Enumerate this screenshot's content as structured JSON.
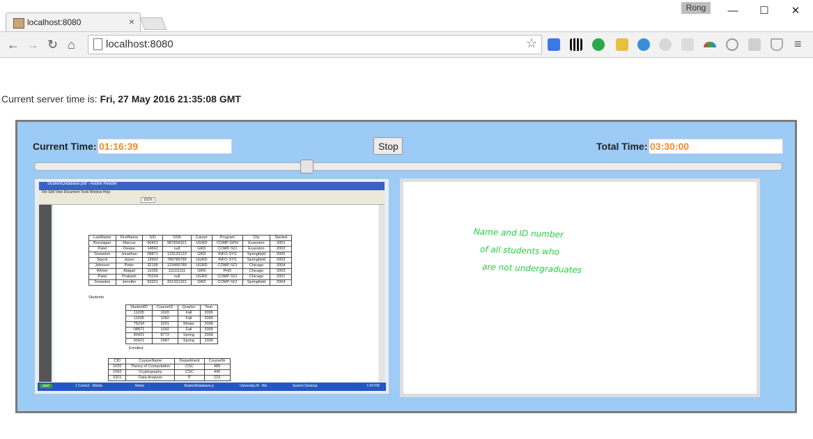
{
  "browser": {
    "tab_title": "localhost:8080",
    "url": "localhost:8080",
    "user_name": "Rong",
    "window_controls": [
      "—",
      "☐",
      "✕"
    ]
  },
  "page": {
    "server_time_label": "Current server time is: ",
    "server_time_value": "Fri, 27 May 2016 21:35:08 GMT"
  },
  "player": {
    "current_time_label": "Current Time:",
    "current_time_value": "01:16:39",
    "total_time_label": "Total Time:",
    "total_time_value": "03:30:00",
    "stop_label": "Stop",
    "progress_fraction": 0.365
  },
  "screen_capture": {
    "window_title": "StudentDatabase.pdf - Adobe Reader",
    "menu": "File  Edit  View  Document  Tools  Window  Help",
    "zoom": "101%",
    "students_caption": "Students",
    "students_headers": [
      "LastName",
      "FirstName",
      "SID",
      "SSN",
      "Career",
      "Program",
      "City",
      "Started"
    ],
    "students_rows": [
      [
        "Brennigan",
        "Marcus",
        "90421",
        "987654321",
        "UGRD",
        "COMP-GPH",
        "Evanston",
        "2001"
      ],
      [
        "Patel",
        "Deepa",
        "14662",
        "null",
        "GRD",
        "COMP-SCI",
        "Evanston",
        "2003"
      ],
      [
        "Snowdon",
        "Jonathan",
        "08871",
        "123123123",
        "GRD",
        "INFO-SYS",
        "Springfield",
        "2005"
      ],
      [
        "Starck",
        "Jason",
        "19992",
        "789789789",
        "UGRD",
        "INFO-SYS",
        "Springfield",
        "2003"
      ],
      [
        "Johnson",
        "Peter",
        "32105",
        "123456789",
        "UGRD",
        "COMP-SCI",
        "Chicago",
        "2004"
      ],
      [
        "Winter",
        "Abigail",
        "11035",
        "111111111",
        "GRD",
        "PHD",
        "Chicago",
        "2003"
      ],
      [
        "Patel",
        "Prakash",
        "75234",
        "null",
        "UGRD",
        "COMP-SCI",
        "Chicago",
        "2001"
      ],
      [
        "Snowdon",
        "Jennifer",
        "93321",
        "321321321",
        "GRD",
        "COMP-SCI",
        "Springfield",
        "2004"
      ]
    ],
    "enrolled_caption": "Enrolled",
    "enrolled_headers": [
      "StudentID",
      "CourseID",
      "Quarter",
      "Year"
    ],
    "enrolled_rows": [
      [
        "11035",
        "1020",
        "Fall",
        "2005"
      ],
      [
        "11035",
        "1092",
        "Fall",
        "2005"
      ],
      [
        "75234",
        "3201",
        "Winter",
        "2006"
      ],
      [
        "08871",
        "1092",
        "Fall",
        "2005"
      ],
      [
        "90421",
        "8772",
        "Spring",
        "2006"
      ],
      [
        "90421",
        "2987",
        "Spring",
        "2006"
      ]
    ],
    "courses_headers": [
      "CID",
      "CourseName",
      "Department",
      "CourseNr"
    ],
    "courses_rows": [
      [
        "1020",
        "Theory of Computation",
        "CSC",
        "489"
      ],
      [
        "1092",
        "Cryptography",
        "CSC",
        "440"
      ],
      [
        "3201",
        "Data Analysis",
        "IT",
        "223"
      ]
    ],
    "taskbar": [
      "start",
      "1 Control - Windo",
      "Notes",
      "StudentDatabase.p",
      "University.rtf - Wo",
      "Search Desktop",
      "7:24 PM"
    ]
  },
  "whiteboard": {
    "lines": [
      "Name and ID number",
      "of all students who",
      "are not undergraduates"
    ],
    "ink_color": "#1fcf3a"
  }
}
